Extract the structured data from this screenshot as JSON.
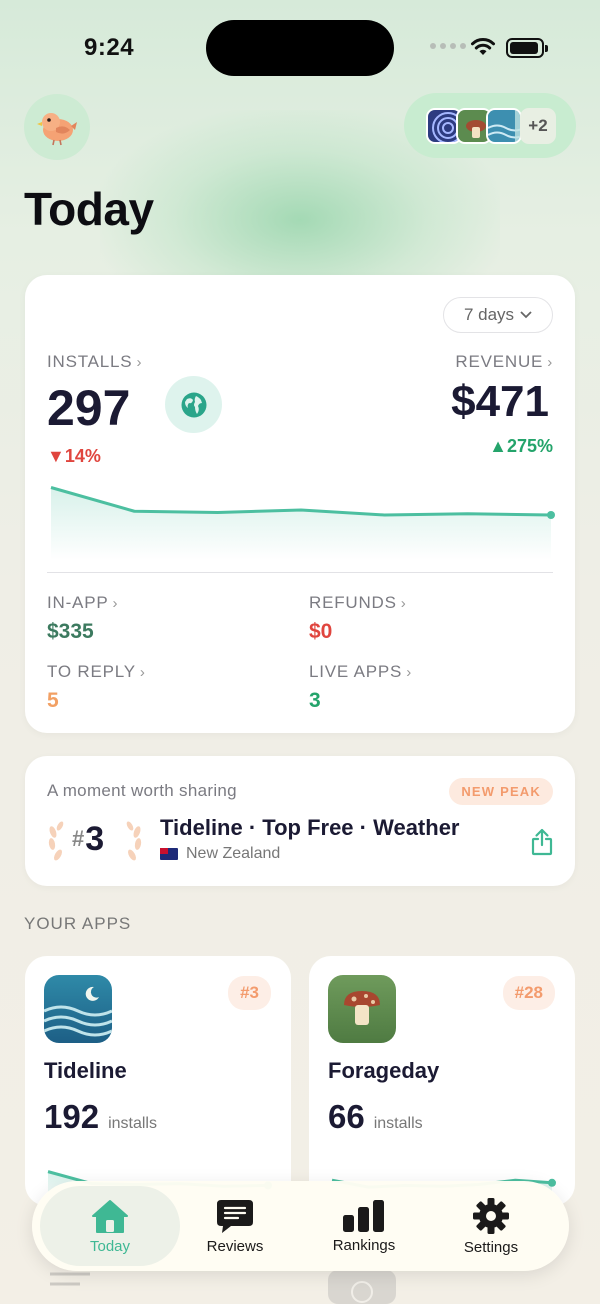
{
  "status_bar": {
    "time": "9:24"
  },
  "header": {
    "title": "Today",
    "more_apps_count": "+2"
  },
  "stats": {
    "range_label": "7 days",
    "installs": {
      "label": "INSTALLS",
      "value": "297",
      "change": "▼14%"
    },
    "revenue": {
      "label": "REVENUE",
      "value": "$471",
      "change": "▲275%"
    },
    "metrics": [
      {
        "label": "IN-APP",
        "value": "$335",
        "color": "#3c7a5f"
      },
      {
        "label": "REFUNDS",
        "value": "$0",
        "color": "#e0453e"
      },
      {
        "label": "TO REPLY",
        "value": "5",
        "color": "#f2a064"
      },
      {
        "label": "LIVE APPS",
        "value": "3",
        "color": "#24a46b"
      }
    ],
    "trend": [
      58,
      39,
      38,
      40,
      36,
      37,
      36
    ],
    "accent": "#4cbfa0"
  },
  "share": {
    "title": "A moment worth sharing",
    "badge": "NEW PEAK",
    "rank": "3",
    "rank_hash": "#",
    "headline": "Tideline · Top Free · Weather",
    "country": "New Zealand"
  },
  "apps_section": {
    "label": "YOUR APPS"
  },
  "apps": [
    {
      "name": "Tideline",
      "rank": "#3",
      "installs": "192",
      "unit": "installs",
      "icon": "tideline-icon",
      "trend": [
        40,
        26,
        25,
        26,
        23,
        24
      ]
    },
    {
      "name": "Forageday",
      "rank": "#28",
      "installs": "66",
      "unit": "installs",
      "icon": "forageday-icon",
      "trend": [
        30,
        22,
        24,
        23,
        25,
        30,
        27
      ]
    }
  ],
  "tabbar": {
    "tabs": [
      {
        "label": "Today",
        "icon": "house-icon"
      },
      {
        "label": "Reviews",
        "icon": "chat-bubble-icon"
      },
      {
        "label": "Rankings",
        "icon": "bar-chart-icon"
      },
      {
        "label": "Settings",
        "icon": "gear-icon"
      }
    ]
  }
}
